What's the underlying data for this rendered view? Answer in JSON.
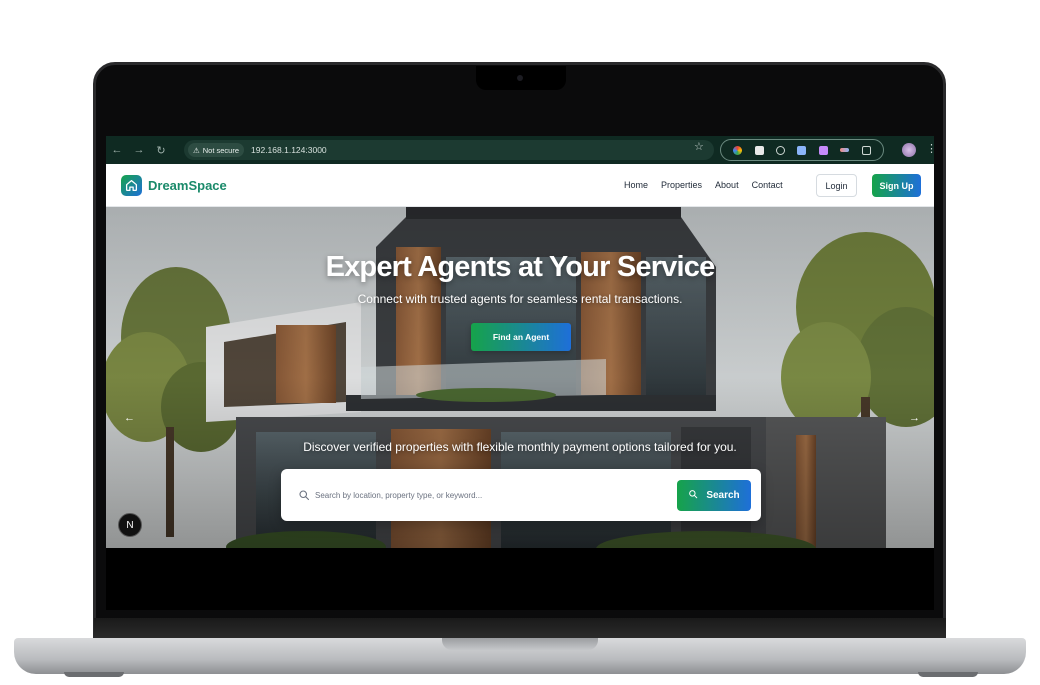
{
  "browser": {
    "security_label": "Not secure",
    "url": "192.168.1.124:3000"
  },
  "brand": {
    "name": "DreamSpace",
    "accent_green": "#16a34a",
    "accent_blue": "#1e6fd9"
  },
  "nav": {
    "links": [
      "Home",
      "Properties",
      "About",
      "Contact"
    ],
    "login_label": "Login",
    "signup_label": "Sign Up"
  },
  "hero": {
    "title": "Expert Agents at Your Service",
    "subtitle": "Connect with trusted agents for seamless rental transactions.",
    "cta_label": "Find an Agent",
    "discover_text": "Discover verified properties with flexible monthly payment options tailored for you."
  },
  "search": {
    "placeholder": "Search by location, property type, or keyword...",
    "button_label": "Search"
  },
  "badge": {
    "letter": "N"
  }
}
